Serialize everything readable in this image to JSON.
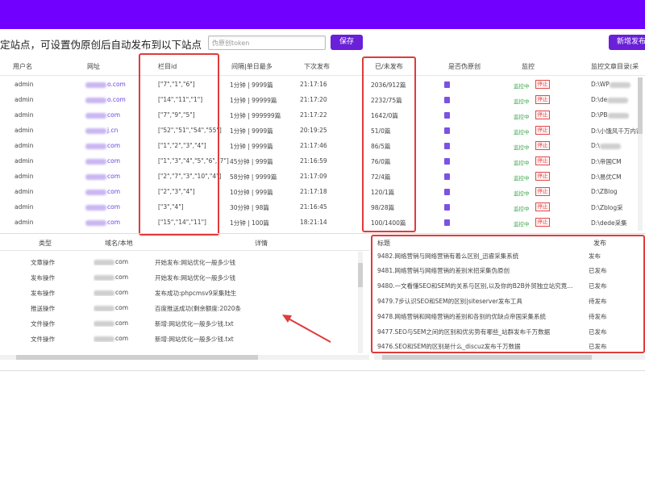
{
  "toolbar": {
    "title": "定站点，可设置伪原创后自动发布到以下站点",
    "input_placeholder": "伪原创token",
    "save_label": "保存",
    "add_label": "新增发布"
  },
  "table": {
    "headers": {
      "user": "用户名",
      "url": "网址",
      "column_id": "栏目id",
      "interval": "间隔|单日最多",
      "next_publish": "下次发布",
      "published": "已/未发布",
      "original": "是否伪原创",
      "monitor": "监控",
      "monitor_dir": "监控文章目录(采"
    },
    "rows": [
      {
        "user": "admin",
        "url": "o.com",
        "column_id": "[\"7\",\"1\",\"6\"]",
        "interval": "1分钟 | 9999篇",
        "next": "21:17:16",
        "published": "2036/912篇",
        "monitoring": "监控中",
        "stop": "停止",
        "dir": "D:\\WP"
      },
      {
        "user": "admin",
        "url": "o.com",
        "column_id": "[\"14\",\"11\",\"1\"]",
        "interval": "1分钟 | 99999篇",
        "next": "21:17:20",
        "published": "2232/75篇",
        "monitoring": "监控中",
        "stop": "停止",
        "dir": "D:\\de"
      },
      {
        "user": "admin",
        "url": "com",
        "column_id": "[\"7\",\"9\",\"5\"]",
        "interval": "1分钟 | 999999篇",
        "next": "21:17:22",
        "published": "1642/0篇",
        "monitoring": "监控中",
        "stop": "停止",
        "dir": "D:\\PB"
      },
      {
        "user": "admin",
        "url": "j.cn",
        "column_id": "[\"52\",\"51\",\"54\",\"55\"]",
        "interval": "1分钟 | 9999篇",
        "next": "20:19:25",
        "published": "51/0篇",
        "monitoring": "监控中",
        "stop": "停止",
        "dir": "D:\\小饿风千万内容"
      },
      {
        "user": "admin",
        "url": "com",
        "column_id": "[\"1\",\"2\",\"3\",\"4\"]",
        "interval": "1分钟 | 9999篇",
        "next": "21:17:46",
        "published": "86/5篇",
        "monitoring": "监控中",
        "stop": "停止",
        "dir": "D:\\"
      },
      {
        "user": "admin",
        "url": "com",
        "column_id": "[\"1\",\"3\",\"4\",\"5\",\"6\",\"7\"]",
        "interval": "45分钟 | 999篇",
        "next": "21:16:59",
        "published": "76/0篇",
        "monitoring": "监控中",
        "stop": "停止",
        "dir": "D:\\帝国CM"
      },
      {
        "user": "admin",
        "url": "com",
        "column_id": "[\"2\",\"7\",\"3\",\"10\",\"4\"]",
        "interval": "58分钟 | 9999篇",
        "next": "21:17:09",
        "published": "72/4篇",
        "monitoring": "监控中",
        "stop": "停止",
        "dir": "D:\\易优CM"
      },
      {
        "user": "admin",
        "url": "com",
        "column_id": "[\"2\",\"3\",\"4\"]",
        "interval": "10分钟 | 999篇",
        "next": "21:17:18",
        "published": "120/1篇",
        "monitoring": "监控中",
        "stop": "停止",
        "dir": "D:\\ZBlog"
      },
      {
        "user": "admin",
        "url": "com",
        "column_id": "[\"3\",\"4\"]",
        "interval": "30分钟 | 98篇",
        "next": "21:16:45",
        "published": "98/28篇",
        "monitoring": "监控中",
        "stop": "停止",
        "dir": "D:\\Zblog采"
      },
      {
        "user": "admin",
        "url": "com",
        "column_id": "[\"15\",\"14\",\"11\"]",
        "interval": "1分钟 | 100篇",
        "next": "18:21:14",
        "published": "100/1400篇",
        "monitoring": "监控中",
        "stop": "停止",
        "dir": "D:\\dede采集"
      }
    ]
  },
  "log": {
    "headers": {
      "type": "类型",
      "domain": "域名/本地",
      "detail": "详情"
    },
    "rows": [
      {
        "type": "文章操作",
        "domain": "com",
        "detail": "开始发布:网站优化一般多少钱"
      },
      {
        "type": "发布操作",
        "domain": "com",
        "detail": "开始发布:网站优化一般多少钱"
      },
      {
        "type": "发布操作",
        "domain": "com",
        "detail": "发布成功:phpcmsv9采集陆生"
      },
      {
        "type": "推送操作",
        "domain": "com",
        "detail": "百度推送成功(剩余额度:2020条"
      },
      {
        "type": "文件操作",
        "domain": "com",
        "detail": "新增:网站优化一般多少钱.txt"
      },
      {
        "type": "文件操作",
        "domain": "com",
        "detail": "新增:网站优化一般多少钱.txt"
      }
    ]
  },
  "articles": {
    "headers": {
      "title": "标题",
      "status": "发布"
    },
    "rows": [
      {
        "title": "9482.网络营销与网络营销有着么区别_迅睿采集系统",
        "status": "发布"
      },
      {
        "title": "9481.网络营销与网络营销的差别米招采集伪原创",
        "status": "已发布"
      },
      {
        "title": "9480.一文看懂SEO和SEM的关系与区别,以及你的B2B外贸独立站究竟...",
        "status": "已发布"
      },
      {
        "title": "9479.7步认识SEO和SEM的区别|siteserver发布工具",
        "status": "待发布"
      },
      {
        "title": "9478.网络营销和网络营销的差别和各别的优缺点帝国采集系统",
        "status": "待发布"
      },
      {
        "title": "9477.SEO与SEM之间的区别和优劣势有哪些_站群发布千万数据",
        "status": "已发布"
      },
      {
        "title": "9476.SEO和SEM的区别是什么_discuz发布千万数据",
        "status": "已发布"
      }
    ]
  },
  "colors": {
    "topbar": "#7200ff",
    "button": "#6a1fd8",
    "highlight": "#e03b3b",
    "monitoring": "#3aa54a"
  }
}
